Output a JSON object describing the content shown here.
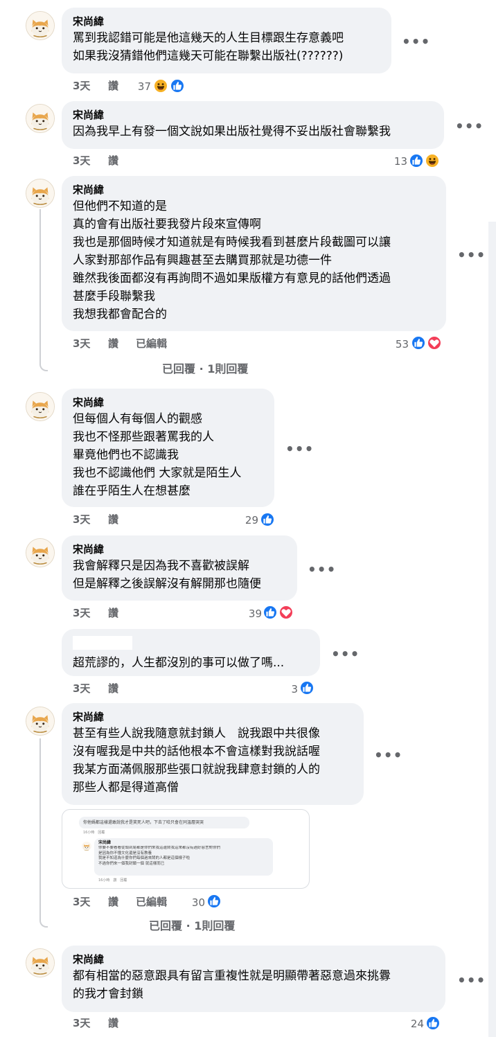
{
  "comments": [
    {
      "author": "宋尚緯",
      "lines": [
        "罵到我認錯可能是他這幾天的人生目標跟生存意義吧",
        "如果我沒猜錯他們這幾天可能在聯繫出版社(??????)"
      ],
      "time": "3天",
      "like_label": "讚",
      "edited": "",
      "count": "37"
    },
    {
      "author": "宋尚緯",
      "lines": [
        "因為我早上有發一個文說如果出版社覺得不妥出版社會聯繫我"
      ],
      "time": "3天",
      "like_label": "讚",
      "edited": "",
      "count": "13"
    },
    {
      "author": "宋尚緯",
      "lines": [
        "但他們不知道的是",
        "真的會有出版社要我發片段來宣傳啊",
        "我也是那個時候才知道就是有時候我看到甚麼片段截圖可以讓",
        "人家對那部作品有興趣甚至去購買那就是功德一件",
        "雖然我後面都沒有再詢問不過如果版權方有意見的話他們透過",
        "甚麼手段聯繫我",
        "我想我都會配合的"
      ],
      "time": "3天",
      "like_label": "讚",
      "edited": "已編輯",
      "count": "53",
      "replies": "已回覆 · 1則回覆"
    },
    {
      "author": "宋尚緯",
      "lines": [
        "但每個人有每個人的觀感",
        "我也不怪那些跟著罵我的人",
        "畢竟他們也不認識我",
        "我也不認識他們 大家就是陌生人",
        "誰在乎陌生人在想甚麼"
      ],
      "time": "3天",
      "like_label": "讚",
      "edited": "",
      "count": "29"
    },
    {
      "author": "宋尚緯",
      "lines": [
        "我會解釋只是因為我不喜歡被誤解",
        "但是解釋之後誤解沒有解開那也隨便"
      ],
      "time": "3天",
      "like_label": "讚",
      "edited": "",
      "count": "39"
    },
    {
      "author": "",
      "lines": [
        "超荒謬的，人生都沒別的事可以做了嗎..."
      ],
      "time": "3天",
      "like_label": "讚",
      "edited": "",
      "count": "3"
    },
    {
      "author": "宋尚緯",
      "lines": [
        "甚至有些人說我隨意就封鎖人　說我跟中共很像",
        "沒有喔我是中共的話他根本不會這樣對我說話喔",
        "我某方面滿佩服那些張口就說我肆意封鎖的人的",
        "那些人都是得道高僧"
      ],
      "time": "3天",
      "like_label": "讚",
      "edited": "已編輯",
      "count": "30",
      "replies": "已回覆 · 1則回覆"
    },
    {
      "author": "宋尚緯",
      "lines": [
        "都有相當的惡意跟具有留言重複性就是明顯帶著惡意過來挑釁",
        "的我才會封鎖"
      ],
      "time": "3天",
      "like_label": "讚",
      "edited": "",
      "count": "24"
    }
  ],
  "screenshot_attachment": {
    "top_text": "你他媽都這樣還敢說我才是笑死人吧，下去了哈只會在同溫層哭哭",
    "top_meta": "16小時　回覆",
    "author": "宋尚緯",
    "lines": [
      "你要不要看看從頭到尾都是你們來我這邊鬧我這來都沒有過好惡言對你們",
      "是因為你不懂文化還是沒有教養",
      "我是不知道為什麼你們每個過來鬧的人都是這個樣子啦",
      "不過你們來一個我封鎖一個 就這樣而已"
    ],
    "meta": "16小時　讚　回覆"
  },
  "colors": {
    "like": "#1877f2",
    "haha": "#f7b125",
    "love": "#f33e58",
    "bubble": "#f0f2f5",
    "meta": "#65676b"
  },
  "icons": {
    "more": "more-options-icon",
    "like": "like-reaction-icon",
    "haha": "haha-reaction-icon",
    "love": "love-reaction-icon"
  }
}
